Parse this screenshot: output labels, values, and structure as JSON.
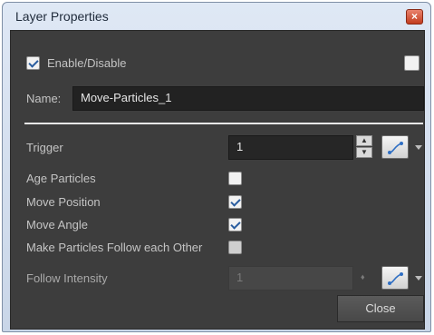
{
  "window": {
    "title": "Layer Properties",
    "close_glyph": "×"
  },
  "enable": {
    "label": "Enable/Disable",
    "checked": true
  },
  "name": {
    "label": "Name:",
    "value": "Move-Particles_1"
  },
  "trigger": {
    "label": "Trigger",
    "value": "1",
    "up_glyph": "▲",
    "down_glyph": "▼"
  },
  "options": [
    {
      "label": "Age Particles",
      "checked": false
    },
    {
      "label": "Move Position",
      "checked": true
    },
    {
      "label": "Move Angle",
      "checked": true
    },
    {
      "label": "Make Particles Follow each Other",
      "checked": false
    }
  ],
  "follow_intensity": {
    "label": "Follow Intensity",
    "value": "1",
    "spin_glyph": "♦"
  },
  "buttons": {
    "close": "Close"
  },
  "icons": {
    "curve": "curve-editor-icon",
    "color_accent": "#2f6fc4"
  }
}
